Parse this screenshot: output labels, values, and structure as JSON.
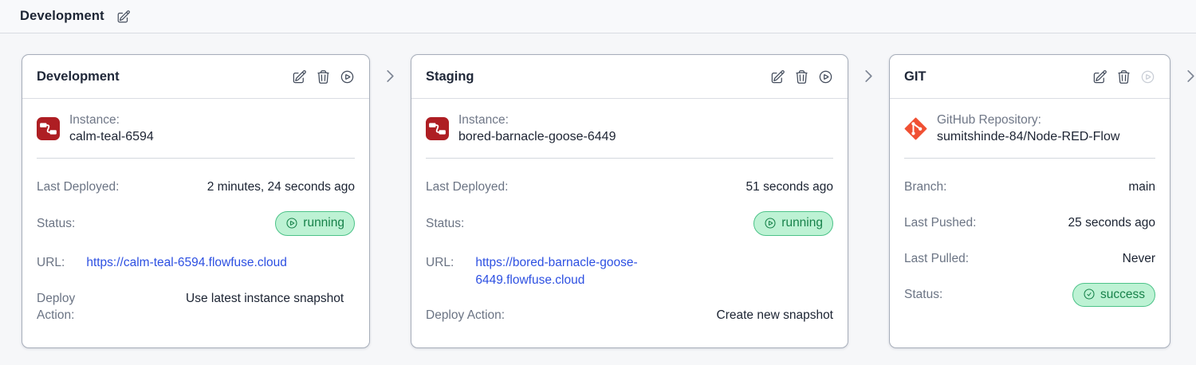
{
  "page": {
    "title": "Development",
    "title_edit_icon": "pencil-square-icon"
  },
  "colors": {
    "link_blue": "#2d50e2",
    "badge_bg": "#bdf2d4",
    "badge_border": "#4cc288",
    "badge_text": "#17824a",
    "node_red_red": "#ae1e23",
    "git_orange": "#f05033"
  },
  "pipeline": {
    "separator_icon": "chevron-right-icon",
    "trailing_separator": true,
    "stages": [
      {
        "name": "Development",
        "actions": [
          {
            "name": "edit-stage",
            "icon": "pencil-square-icon",
            "disabled": false
          },
          {
            "name": "delete-stage",
            "icon": "trash-icon",
            "disabled": false
          },
          {
            "name": "run-stage",
            "icon": "play-circle-icon",
            "disabled": false
          }
        ],
        "source": {
          "icon": "node-red-instance-icon",
          "label": "Instance:",
          "value": "calm-teal-6594"
        },
        "rows": [
          {
            "label": "Last Deployed:",
            "value": "2 minutes, 24 seconds ago",
            "type": "text"
          },
          {
            "label": "Status:",
            "value": "running",
            "type": "badge",
            "badge_icon": "play-circle-icon"
          },
          {
            "label": "URL:",
            "value": "https://calm-teal-6594.flowfuse.cloud",
            "type": "link"
          },
          {
            "label": "Deploy Action:",
            "value": "Use latest instance snapshot",
            "type": "text",
            "narrow": true
          }
        ]
      },
      {
        "name": "Staging",
        "actions": [
          {
            "name": "edit-stage",
            "icon": "pencil-square-icon",
            "disabled": false
          },
          {
            "name": "delete-stage",
            "icon": "trash-icon",
            "disabled": false
          },
          {
            "name": "run-stage",
            "icon": "play-circle-icon",
            "disabled": false
          }
        ],
        "source": {
          "icon": "node-red-instance-icon",
          "label": "Instance:",
          "value": "bored-barnacle-goose-6449"
        },
        "rows": [
          {
            "label": "Last Deployed:",
            "value": "51 seconds ago",
            "type": "text"
          },
          {
            "label": "Status:",
            "value": "running",
            "type": "badge",
            "badge_icon": "play-circle-icon"
          },
          {
            "label": "URL:",
            "value": "https://bored-barnacle-goose-6449.flowfuse.cloud",
            "type": "link"
          },
          {
            "label": "Deploy Action:",
            "value": "Create new snapshot",
            "type": "text"
          }
        ]
      },
      {
        "name": "GIT",
        "actions": [
          {
            "name": "edit-stage",
            "icon": "pencil-square-icon",
            "disabled": false
          },
          {
            "name": "delete-stage",
            "icon": "trash-icon",
            "disabled": false
          },
          {
            "name": "run-stage",
            "icon": "play-circle-icon",
            "disabled": true
          }
        ],
        "source": {
          "icon": "git-icon",
          "label": "GitHub Repository:",
          "value": "sumitshinde-84/Node-RED-Flow"
        },
        "rows": [
          {
            "label": "Branch:",
            "value": "main",
            "type": "text"
          },
          {
            "label": "Last Pushed:",
            "value": "25 seconds ago",
            "type": "text"
          },
          {
            "label": "Last Pulled:",
            "value": "Never",
            "type": "text"
          },
          {
            "label": "Status:",
            "value": "success",
            "type": "badge",
            "badge_icon": "check-circle-icon"
          }
        ]
      }
    ]
  }
}
